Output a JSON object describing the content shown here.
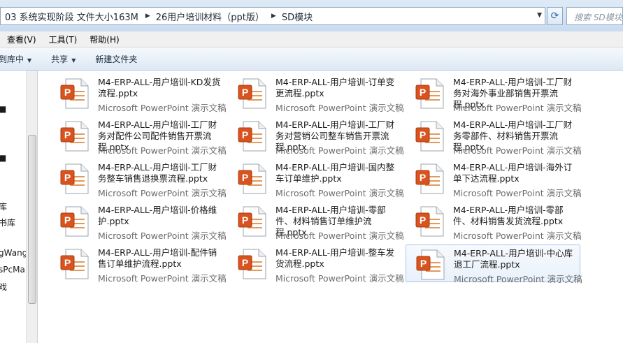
{
  "address_bar": {
    "crumbs": [
      "03 系统实现阶段 文件大小163M",
      "26用户培训材料（ppt版）",
      "SD模块"
    ],
    "search_placeholder": "搜索 SD模块"
  },
  "menu": [
    "查看(V)",
    "工具(T)",
    "帮助(H)"
  ],
  "toolbar": {
    "include_library": "到库中",
    "share": "共享",
    "new_folder": "新建文件夹"
  },
  "nav_items": [
    "库",
    "书库",
    "gWang",
    "sPcMa",
    "戏"
  ],
  "file_type": "Microsoft PowerPoint 演示文稿",
  "files": [
    {
      "name": "M4-ERP-ALL-用户培训-KD发货流程.pptx"
    },
    {
      "name": "M4-ERP-ALL-用户培训-订单变更流程.pptx"
    },
    {
      "name": "M4-ERP-ALL-用户培训-工厂财务对海外事业部销售开票流程.pptx"
    },
    {
      "name": "M4-ERP-ALL-用户培训-工厂财务对配件公司配件销售开票流程.pptx"
    },
    {
      "name": "M4-ERP-ALL-用户培训-工厂财务对营销公司整车销售开票流程.pptx"
    },
    {
      "name": "M4-ERP-ALL-用户培训-工厂财务零部件、材料销售开票流程.pptx"
    },
    {
      "name": "M4-ERP-ALL-用户培训-工厂财务整车销售退换票流程.pptx"
    },
    {
      "name": "M4-ERP-ALL-用户培训-国内整车订单维护.pptx"
    },
    {
      "name": "M4-ERP-ALL-用户培训-海外订单下达流程.pptx"
    },
    {
      "name": "M4-ERP-ALL-用户培训-价格维护.pptx"
    },
    {
      "name": "M4-ERP-ALL-用户培训-零部件、材料销售订单维护流程.pptx"
    },
    {
      "name": "M4-ERP-ALL-用户培训-零部件、材料销售发货流程.pptx"
    },
    {
      "name": "M4-ERP-ALL-用户培训-配件销售订单维护流程.pptx"
    },
    {
      "name": "M4-ERP-ALL-用户培训-整车发货流程.pptx"
    },
    {
      "name": "M4-ERP-ALL-用户培训-中心库退工厂流程.pptx",
      "selected": true
    }
  ]
}
